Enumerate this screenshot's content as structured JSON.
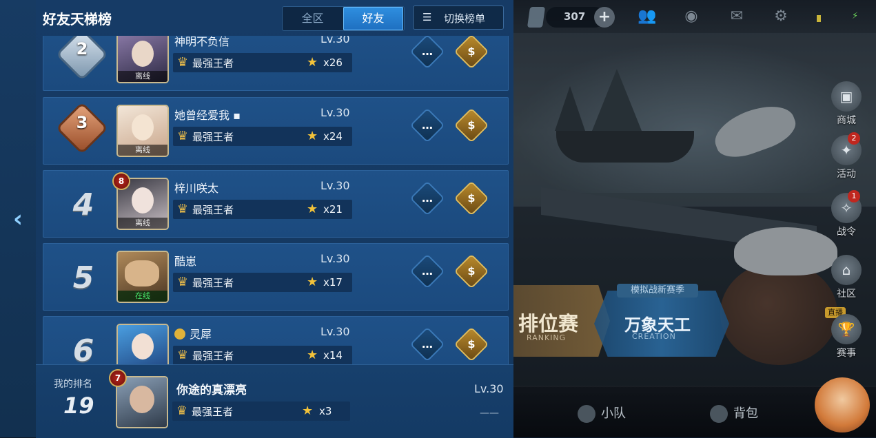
{
  "panel": {
    "title": "好友天梯榜",
    "tabs": [
      {
        "label": "全区",
        "active": false
      },
      {
        "label": "好友",
        "active": true
      }
    ],
    "switch_label": "切换榜单",
    "switch_icon": "list-icon"
  },
  "rows": [
    {
      "rank": "2",
      "badge": "silver",
      "name": "神明不负信",
      "level": "Lv.30",
      "status": "离线",
      "tier": "最强王者",
      "stars": "x26"
    },
    {
      "rank": "3",
      "badge": "bronze",
      "name": "她曾经爱我 ▪",
      "level": "Lv.30",
      "status": "离线",
      "tier": "最强王者",
      "stars": "x24"
    },
    {
      "rank": "4",
      "badge": "",
      "name": "梓川咲太",
      "level": "Lv.30",
      "status": "离线",
      "tier": "最强王者",
      "stars": "x21",
      "vip": "8"
    },
    {
      "rank": "5",
      "badge": "",
      "name": "酷崽",
      "level": "Lv.30",
      "status": "在线",
      "tier": "最强王者",
      "stars": "x17"
    },
    {
      "rank": "6",
      "badge": "",
      "name": "灵犀",
      "level": "Lv.30",
      "status": "",
      "tier": "最强王者",
      "stars": "x14"
    }
  ],
  "my_rank": {
    "label": "我的排名",
    "rank": "19",
    "vip": "7",
    "name": "你途的真漂亮",
    "level": "Lv.30",
    "tier": "最强王者",
    "stars": "x3",
    "extra": "——"
  },
  "topbar": {
    "currency": "307",
    "plus": "+"
  },
  "side_menu": [
    {
      "label": "商城",
      "icon": "shop-icon",
      "badge": ""
    },
    {
      "label": "活动",
      "icon": "gift-box-icon",
      "badge": "2"
    },
    {
      "label": "战令",
      "icon": "pass-icon",
      "badge": "1"
    },
    {
      "label": "社区",
      "icon": "community-icon",
      "badge": ""
    },
    {
      "label": "赛事",
      "icon": "trophy-icon",
      "badge": ""
    }
  ],
  "live_tag": "直播",
  "modes": {
    "rank_title": "排位赛",
    "rank_sub": "RANKING",
    "sim_tag": "模拟战新赛季",
    "sim_title": "万象天工",
    "sim_sub": "CREATION"
  },
  "bottom_nav": [
    {
      "label": "小队",
      "icon": "team-flag-icon"
    },
    {
      "label": "背包",
      "icon": "backpack-icon"
    }
  ],
  "colors": {
    "accent": "#2f8fe0",
    "panel": "#163b66",
    "gold": "#e0bb5a",
    "online": "#49e46a"
  }
}
